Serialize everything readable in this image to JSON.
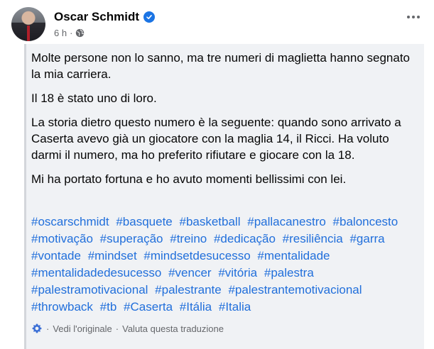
{
  "post": {
    "author": "Oscar Schmidt",
    "time": "6 h",
    "meta_sep": "·",
    "paragraphs": [
      "Molte persone non lo sanno, ma tre numeri di maglietta hanno segnato la mia carriera.",
      "Il 18 è stato uno di loro.",
      "La storia dietro questo numero è la seguente: quando sono arrivato a Caserta avevo già un giocatore con la maglia 14, il Ricci. Ha voluto darmi il numero, ma ho preferito rifiutare e giocare con la 18.",
      "Mi ha portato fortuna e ho avuto momenti bellissimi con lei."
    ],
    "hashtags": [
      "#oscarschmidt",
      "#basquete",
      "#basketball",
      "#pallacanestro",
      "#baloncesto",
      "#motivação",
      "#superação",
      "#treino",
      "#dedicação",
      "#resiliência",
      "#garra",
      "#vontade",
      "#mindset",
      "#mindsetdesucesso",
      "#mentalidade",
      "#mentalidadedesucesso",
      "#vencer",
      "#vitória",
      "#palestra",
      "#palestramotivacional",
      "#palestrante",
      "#palestrantemotivacional",
      "#throwback",
      "#tb",
      "#Caserta",
      "#Itália",
      "#Italia"
    ],
    "translation": {
      "sep": "·",
      "see_original": "Vedi l'originale",
      "rate": "Valuta questa traduzione"
    }
  },
  "colors": {
    "link": "#216fdb",
    "verified": "#1b74e4",
    "muted": "#65676b",
    "body_bg": "#f0f2f5"
  }
}
